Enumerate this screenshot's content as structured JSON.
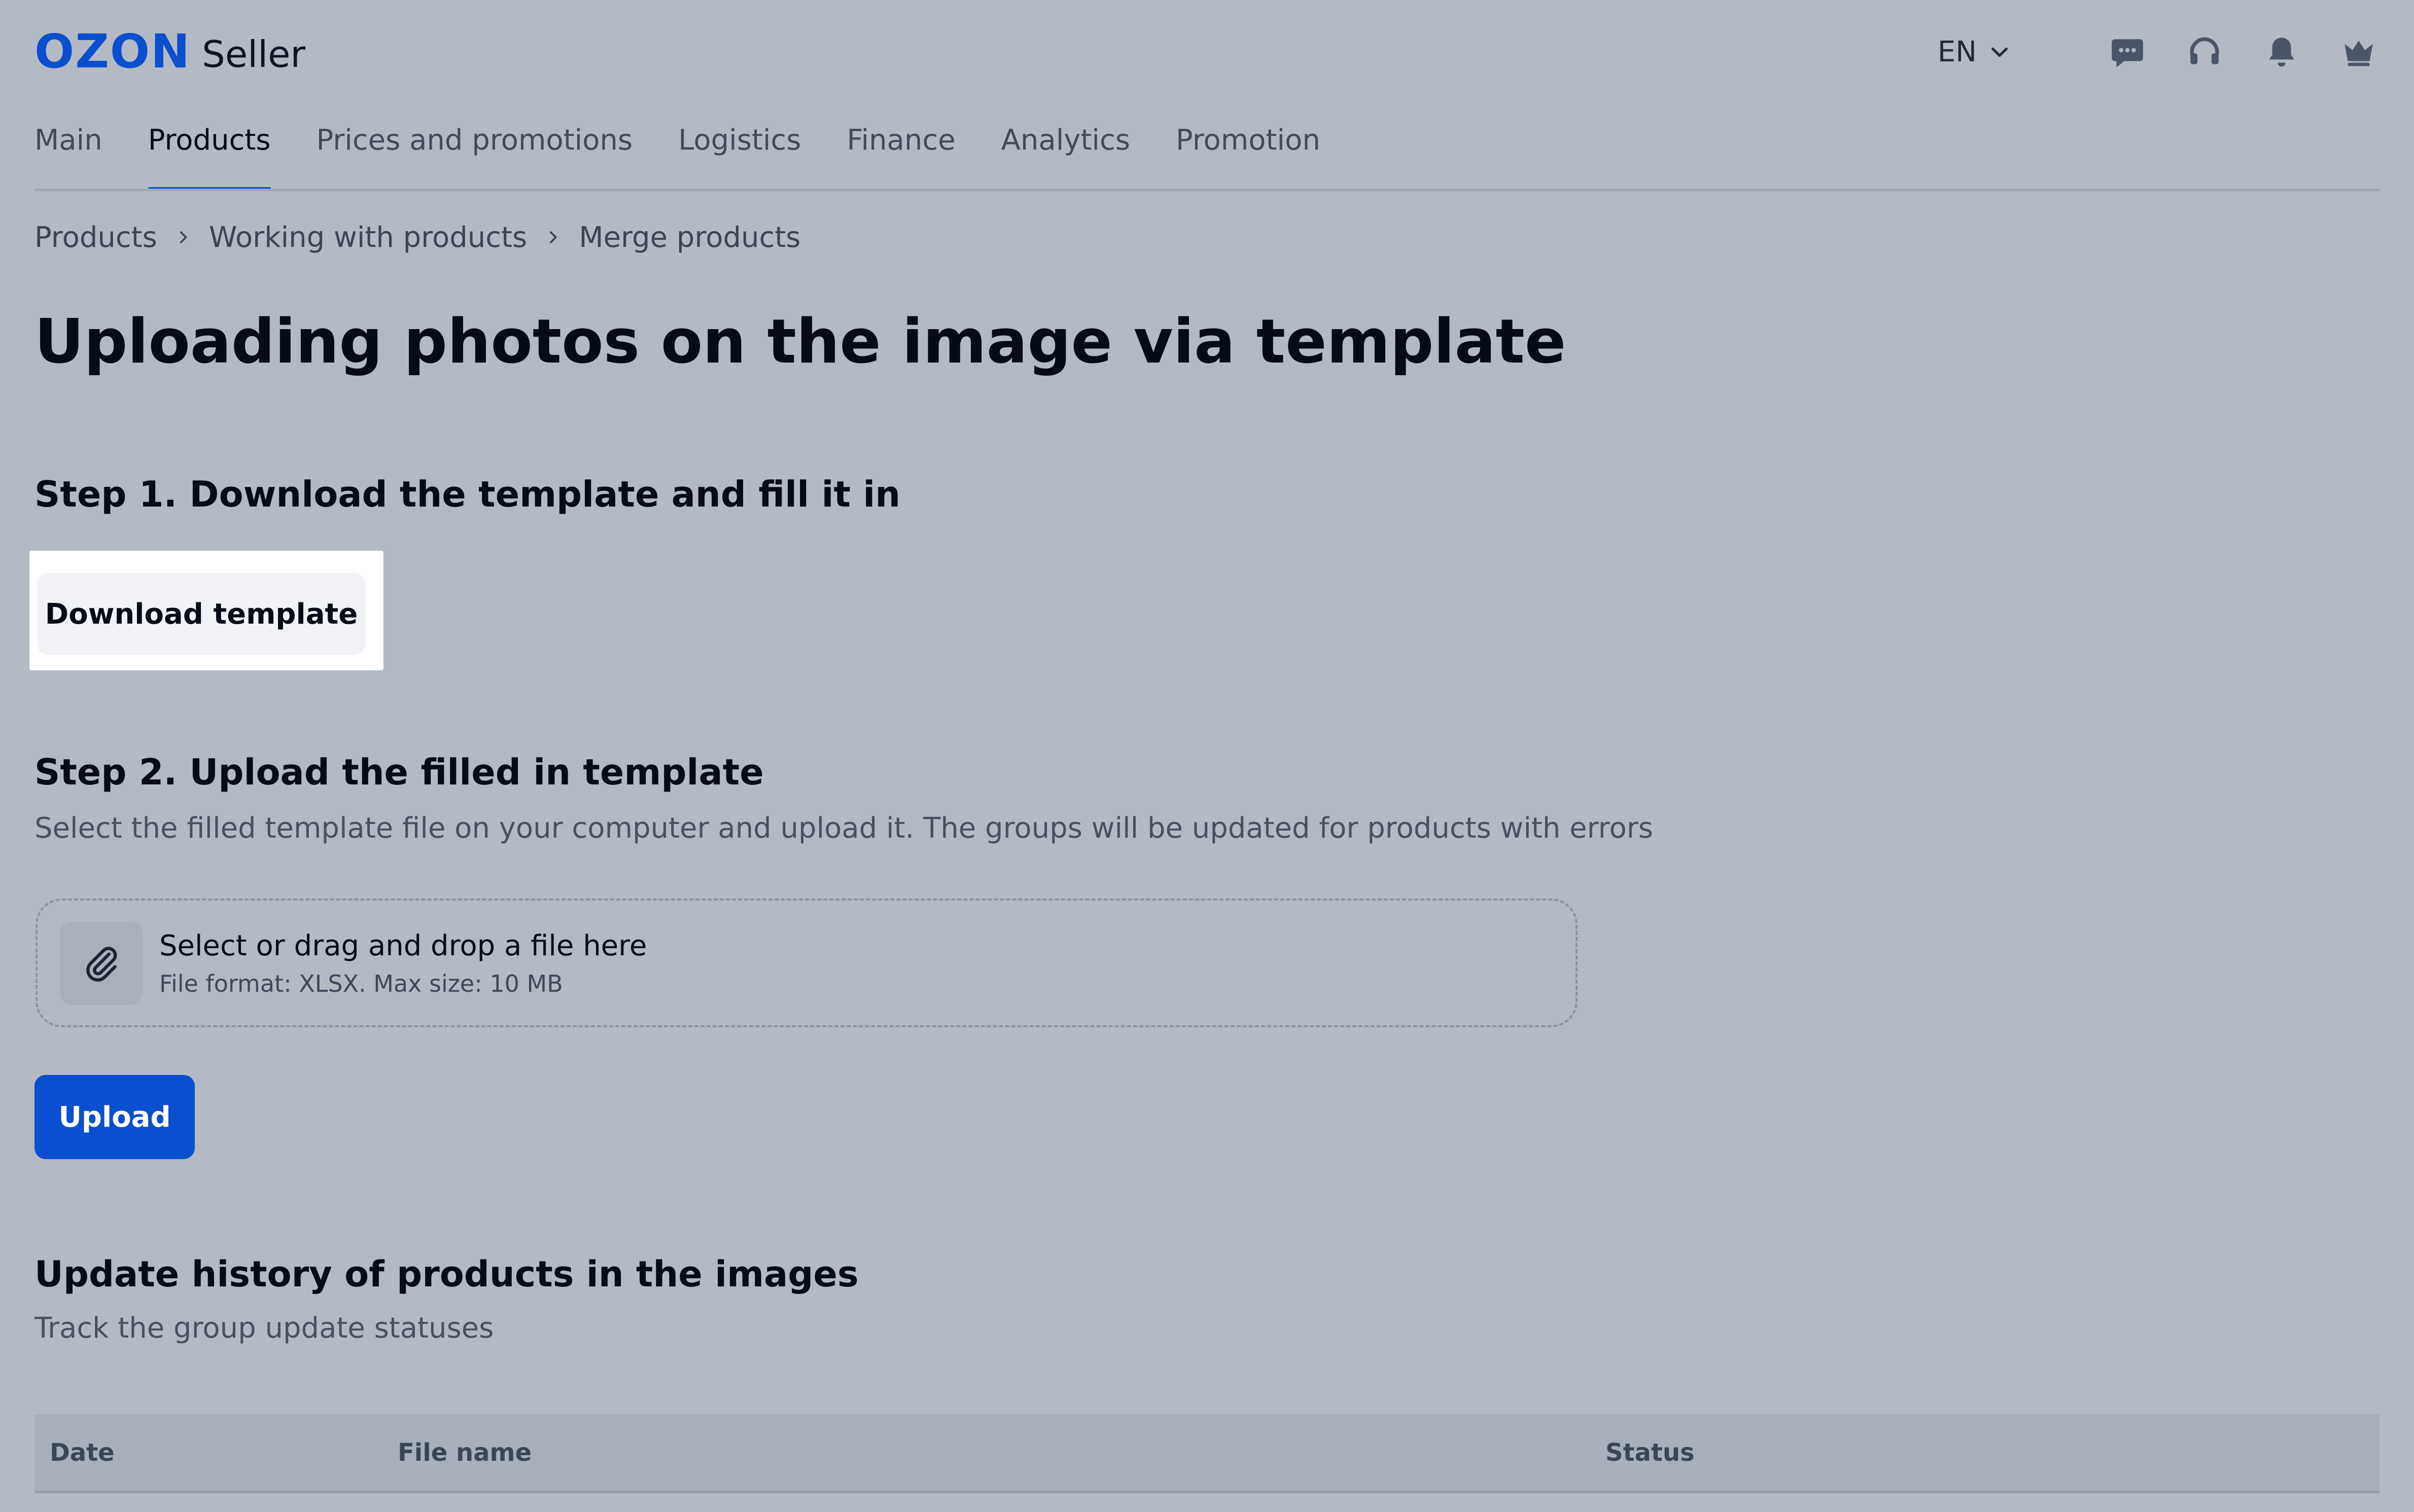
{
  "header": {
    "logo_brand": "OZON",
    "logo_product": "Seller",
    "language": "EN",
    "icons": [
      "chat-icon",
      "headset-icon",
      "bell-icon",
      "crown-icon"
    ]
  },
  "nav": {
    "items": [
      {
        "label": "Main",
        "active": false
      },
      {
        "label": "Products",
        "active": true
      },
      {
        "label": "Prices and promotions",
        "active": false
      },
      {
        "label": "Logistics",
        "active": false
      },
      {
        "label": "Finance",
        "active": false
      },
      {
        "label": "Analytics",
        "active": false
      },
      {
        "label": "Promotion",
        "active": false
      }
    ]
  },
  "breadcrumb": [
    "Products",
    "Working with products",
    "Merge products"
  ],
  "page_title": "Uploading photos on the image via template",
  "step1": {
    "title": "Step 1. Download the template and fill it in",
    "button": "Download template"
  },
  "step2": {
    "title": "Step 2. Upload the filled in template",
    "description": "Select the filled template file on your computer and upload it. The groups will be updated for products with errors",
    "dropzone_title": "Select or drag and drop a file here",
    "dropzone_hint": "File format: XLSX. Max size: 10 MB",
    "upload_button": "Upload"
  },
  "history": {
    "title": "Update history of products in the images",
    "description": "Track the group update statuses",
    "columns": [
      "Date",
      "File name",
      "Status"
    ]
  },
  "colors": {
    "accent": "#0a4fcf",
    "background": "#b3bac3",
    "text": "#070b15"
  }
}
